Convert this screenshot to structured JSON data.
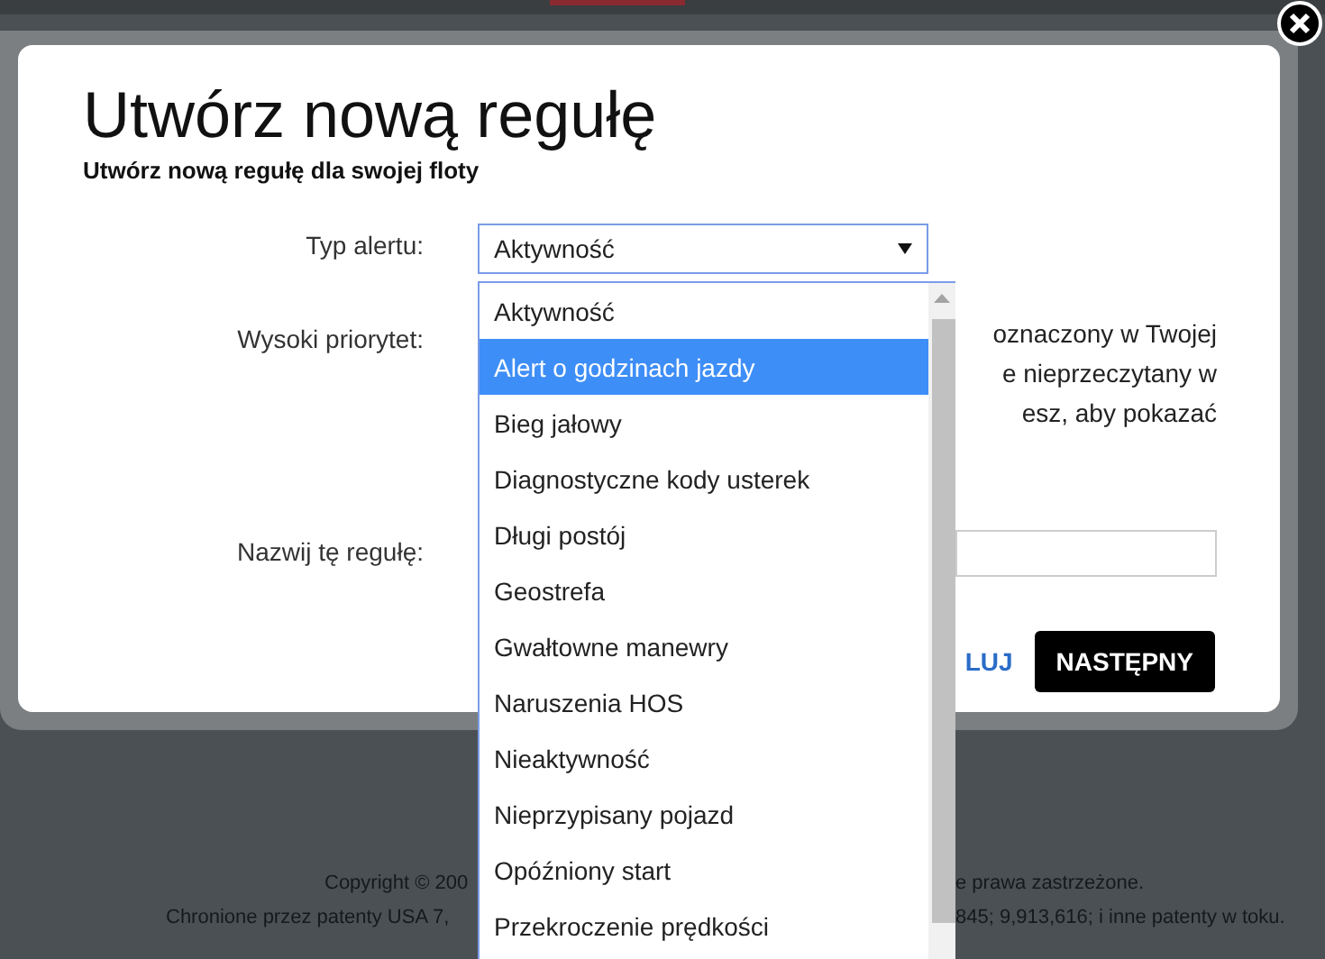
{
  "background": {
    "footer": {
      "line_1_left": "Copyright © 200",
      "line_1_right": "e prawa zastrzeżone.",
      "line_2_left": "Chronione przez patenty USA 7,",
      "line_2_right": "845; 9,913,616; i inne patenty w toku."
    }
  },
  "dialog": {
    "title": "Utwórz nową regułę",
    "subtitle": "Utwórz nową regułę dla swojej floty",
    "fields": [
      {
        "label": "Typ alertu:",
        "kind": "select",
        "value": "Aktywność"
      },
      {
        "label": "Wysoki priorytet:",
        "kind": "note",
        "lines": [
          "oznaczony w Twojej",
          "e nieprzeczytany w",
          "esz, aby pokazać"
        ]
      },
      {
        "label": "Nazwij tę regułę:",
        "kind": "text"
      }
    ],
    "cancel_link": "LUJ",
    "next_button": "NASTĘPNY",
    "dropdown": {
      "options": [
        {
          "label": "Aktywność",
          "selected": false
        },
        {
          "label": "Alert o godzinach jazdy",
          "selected": true
        },
        {
          "label": "Bieg jałowy",
          "selected": false
        },
        {
          "label": "Diagnostyczne kody usterek",
          "selected": false
        },
        {
          "label": "Długi postój",
          "selected": false
        },
        {
          "label": "Geostrefa",
          "selected": false
        },
        {
          "label": "Gwałtowne manewry",
          "selected": false
        },
        {
          "label": "Naruszenia HOS",
          "selected": false
        },
        {
          "label": "Nieaktywność",
          "selected": false
        },
        {
          "label": "Nieprzypisany pojazd",
          "selected": false
        },
        {
          "label": "Opóźniony start",
          "selected": false
        },
        {
          "label": "Przekroczenie prędkości",
          "selected": false
        }
      ]
    }
  }
}
